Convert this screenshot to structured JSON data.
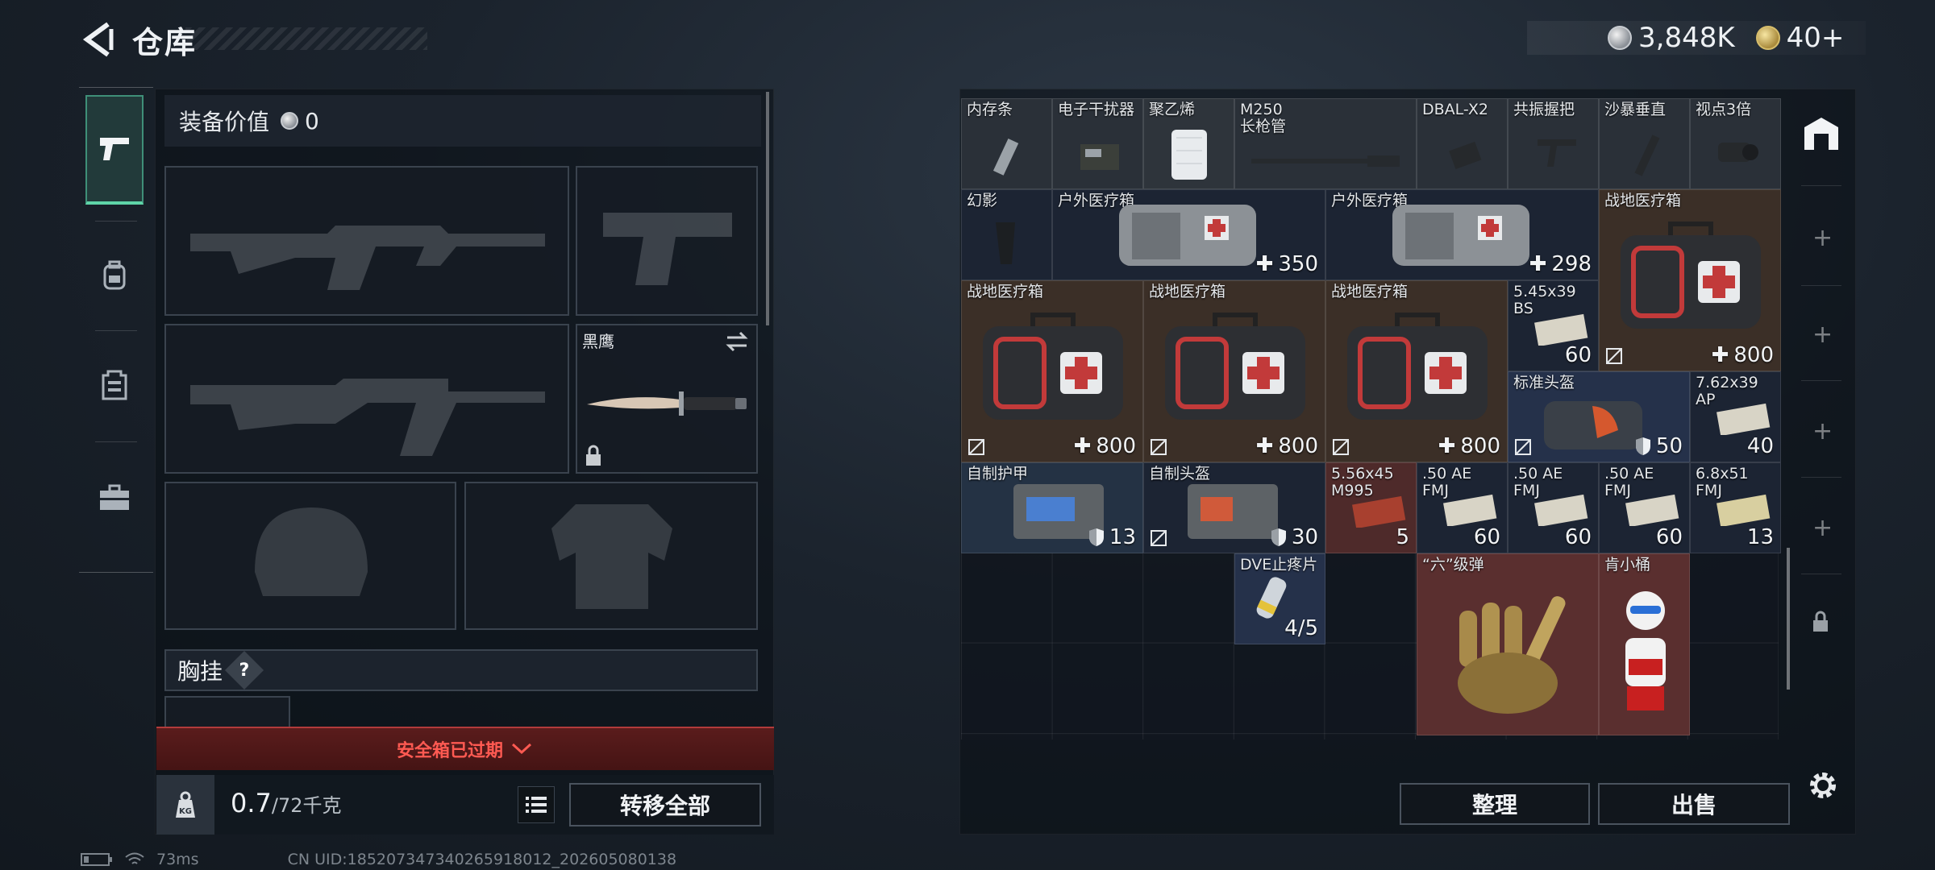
{
  "header": {
    "title": "仓库",
    "currency_silver": "3,848K",
    "currency_gold": "40+"
  },
  "left": {
    "equip_value_label": "装备价值",
    "equip_value": "0",
    "melee_name": "黑鹰",
    "chest_rig_label": "胸挂",
    "chest_rig_badge": "?",
    "safe_box_status": "安全箱已过期",
    "weight_current": "0.7",
    "weight_max": "/72千克",
    "transfer_all_label": "转移全部"
  },
  "stash": {
    "items": [
      {
        "name": "内存条"
      },
      {
        "name": "电子干扰器"
      },
      {
        "name": "聚乙烯"
      },
      {
        "name": "M250\n长枪管"
      },
      {
        "name": "DBAL-X2"
      },
      {
        "name": "共振握把"
      },
      {
        "name": "沙暴垂直"
      },
      {
        "name": "视点3倍"
      },
      {
        "name": "幻影"
      },
      {
        "name": "户外医疗箱",
        "qty": "350"
      },
      {
        "name": "户外医疗箱",
        "qty": "298"
      },
      {
        "name": "战地医疗箱",
        "qty": "800"
      },
      {
        "name": "战地医疗箱",
        "qty": "800"
      },
      {
        "name": "战地医疗箱",
        "qty": "800"
      },
      {
        "name": "战地医疗箱",
        "qty": "800"
      },
      {
        "name": "5.45x39\nBS",
        "qty": "60"
      },
      {
        "name": "标准头盔",
        "qty": "50"
      },
      {
        "name": "7.62x39\nAP",
        "qty": "40"
      },
      {
        "name": "自制护甲",
        "qty": "13"
      },
      {
        "name": "自制头盔",
        "qty": "30"
      },
      {
        "name": "5.56x45\nM995",
        "qty": "5"
      },
      {
        "name": ".50 AE\nFMJ",
        "qty": "60"
      },
      {
        "name": ".50 AE\nFMJ",
        "qty": "60"
      },
      {
        "name": ".50 AE\nFMJ",
        "qty": "60"
      },
      {
        "name": "6.8x51\nFMJ",
        "qty": "13"
      },
      {
        "name": "DVE止疼片",
        "qty": "4/5"
      },
      {
        "name": "“六”级弹"
      },
      {
        "name": "肯小桶"
      }
    ],
    "sort_label": "整理",
    "sell_label": "出售"
  },
  "footer": {
    "ping": "73ms",
    "uid": "CN UID:185207347340265918012_202605080138"
  },
  "colors": {
    "accent_green": "#5fd4a8",
    "alert_red": "#ff5a52"
  }
}
